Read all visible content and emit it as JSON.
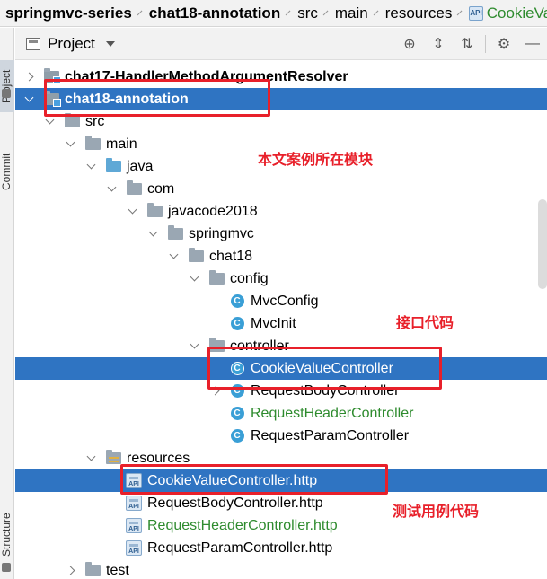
{
  "breadcrumb": {
    "items": [
      "springmvc-series",
      "chat18-annotation",
      "src",
      "main",
      "resources",
      "CookieValueController.http"
    ],
    "last_visible": "CookieVa"
  },
  "toolwindow": {
    "left_tabs": [
      "Project",
      "Commit",
      "Structure"
    ],
    "title": "Project",
    "toolbar_icons": [
      "locate-icon",
      "expand-all-icon",
      "collapse-all-icon",
      "gear-icon",
      "minimize-icon"
    ]
  },
  "tree": [
    {
      "label": "chat17-HandlerMethodArgumentResolver",
      "bold": true,
      "icon": "module-folder",
      "arrow": "right",
      "depth": 0
    },
    {
      "label": "chat18-annotation",
      "bold": true,
      "icon": "module-folder",
      "arrow": "down",
      "depth": 0,
      "selected": true
    },
    {
      "label": "src",
      "icon": "folder",
      "arrow": "down",
      "depth": 1
    },
    {
      "label": "main",
      "icon": "folder",
      "arrow": "down",
      "depth": 2
    },
    {
      "label": "java",
      "icon": "source-folder",
      "arrow": "down",
      "depth": 3
    },
    {
      "label": "com",
      "icon": "package",
      "arrow": "down",
      "depth": 4
    },
    {
      "label": "javacode2018",
      "icon": "package",
      "arrow": "down",
      "depth": 5
    },
    {
      "label": "springmvc",
      "icon": "package",
      "arrow": "down",
      "depth": 6
    },
    {
      "label": "chat18",
      "icon": "package",
      "arrow": "down",
      "depth": 7
    },
    {
      "label": "config",
      "icon": "package",
      "arrow": "down",
      "depth": 8
    },
    {
      "label": "MvcConfig",
      "icon": "class",
      "depth": 9
    },
    {
      "label": "MvcInit",
      "icon": "class",
      "depth": 9
    },
    {
      "label": "controller",
      "icon": "package",
      "arrow": "down",
      "depth": 8
    },
    {
      "label": "CookieValueController",
      "icon": "class",
      "depth": 9,
      "selected": true
    },
    {
      "label": "RequestBodyController",
      "icon": "class",
      "arrow": "right",
      "depth": 9
    },
    {
      "label": "RequestHeaderController",
      "icon": "class",
      "depth": 9,
      "green": true
    },
    {
      "label": "RequestParamController",
      "icon": "class",
      "depth": 9
    },
    {
      "label": "resources",
      "icon": "resources-folder",
      "arrow": "down",
      "depth": 3
    },
    {
      "label": "CookieValueController.http",
      "icon": "api-file",
      "depth": 4,
      "selected": true
    },
    {
      "label": "RequestBodyController.http",
      "icon": "api-file",
      "depth": 4
    },
    {
      "label": "RequestHeaderController.http",
      "icon": "api-file",
      "depth": 4,
      "green": true
    },
    {
      "label": "RequestParamController.http",
      "icon": "api-file",
      "depth": 4
    },
    {
      "label": "test",
      "icon": "folder",
      "arrow": "right",
      "depth": 2
    }
  ],
  "annotations": {
    "module": "本文案例所在模块",
    "interface": "接口代码",
    "test": "测试用例代码"
  },
  "colors": {
    "selection": "#2f74c2",
    "annotation": "#e8202a",
    "modified_text": "#2e8b2e"
  }
}
